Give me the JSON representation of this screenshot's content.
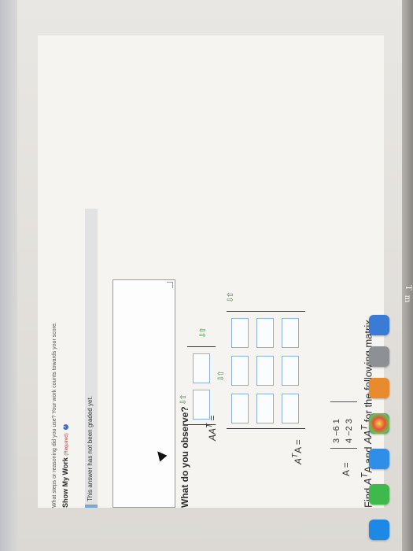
{
  "problem": {
    "title_prefix": "Find ",
    "title_ata": "A",
    "title_t1": "T",
    "title_mid1": "A and ",
    "title_aat": "AA",
    "title_t2": "T",
    "title_suffix": " for the following matrix.",
    "matrix_label": "A =",
    "matrix_row1": "3  −6  1",
    "matrix_row2": "4  −2  3"
  },
  "answers": {
    "ata_label": "A",
    "ata_sup": "T",
    "ata_label_tail": "A =",
    "aat_label": "AA",
    "aat_sup": "T",
    "aat_label_tail": " ="
  },
  "observe": {
    "label": "What do you observe?",
    "answer_value": ""
  },
  "grading": {
    "status": "This answer has not been graded yet."
  },
  "show_work": {
    "label": "Show My Work",
    "required": "(Required)",
    "help": "?",
    "description": "What steps or reasoning did you use? Your work counts towards your score."
  },
  "edge": {
    "glyph1": "T",
    "glyph2": "m"
  },
  "colors": {
    "cell_border": "#8fb3d8",
    "arrow": "#3a8b3a",
    "graded_accent": "#7aa7d1"
  },
  "icons": {
    "stepper": "up-down-arrows-icon",
    "help": "question-circle-icon",
    "cursor": "mouse-pointer-icon"
  }
}
